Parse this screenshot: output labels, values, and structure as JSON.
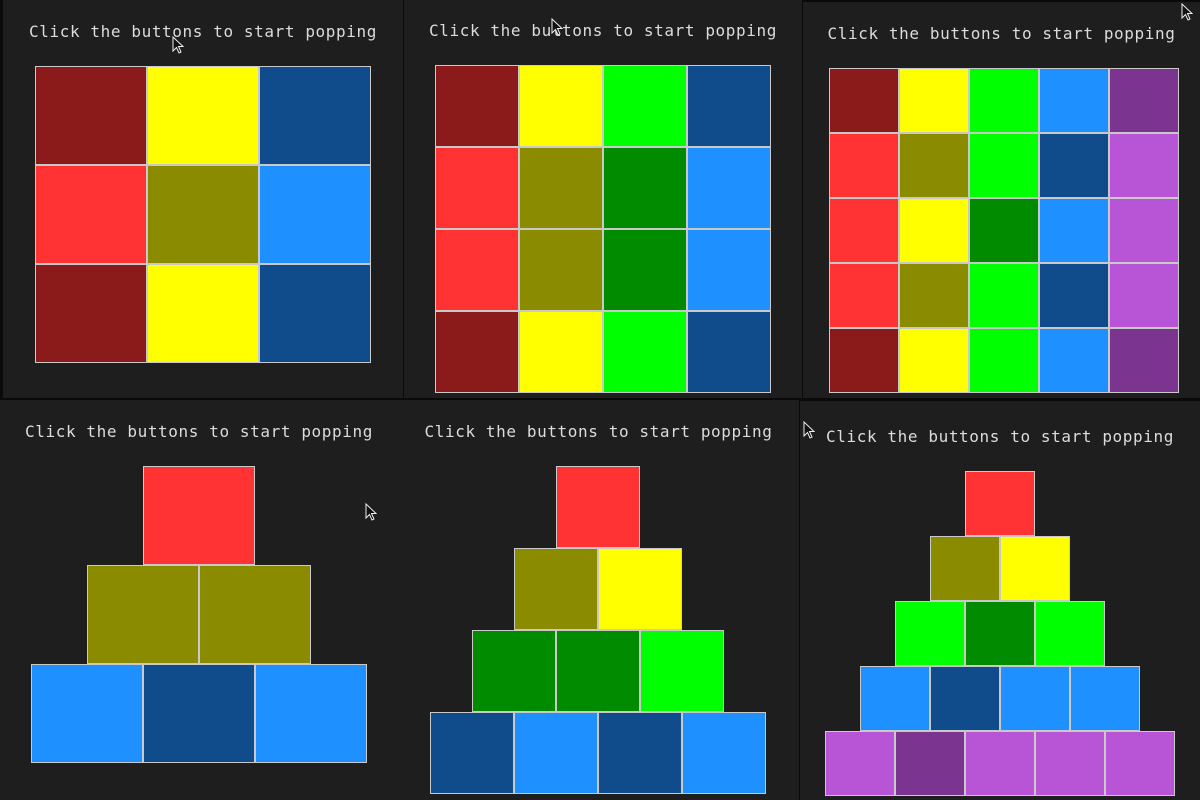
{
  "title": "Click the buttons to start popping",
  "colors": {
    "dark-red": "#8b1a1a",
    "red": "#ff3333",
    "yellow": "#ffff00",
    "olive": "#8b8b00",
    "lime": "#00ff00",
    "green": "#008b00",
    "blue": "#1e90ff",
    "navy": "#104c8b",
    "purple": "#7b3590",
    "orchid": "#b854d6"
  },
  "grids": [
    {
      "rows": [
        [
          "dark-red",
          "yellow",
          "navy"
        ],
        [
          "red",
          "olive",
          "blue"
        ],
        [
          "dark-red",
          "yellow",
          "navy"
        ]
      ]
    },
    {
      "rows": [
        [
          "dark-red",
          "yellow",
          "lime",
          "navy"
        ],
        [
          "red",
          "olive",
          "green",
          "blue"
        ],
        [
          "red",
          "olive",
          "green",
          "blue"
        ],
        [
          "dark-red",
          "yellow",
          "lime",
          "navy"
        ]
      ]
    },
    {
      "rows": [
        [
          "dark-red",
          "yellow",
          "lime",
          "blue",
          "purple"
        ],
        [
          "red",
          "olive",
          "lime",
          "navy",
          "orchid"
        ],
        [
          "red",
          "yellow",
          "green",
          "blue",
          "orchid"
        ],
        [
          "red",
          "olive",
          "lime",
          "navy",
          "orchid"
        ],
        [
          "dark-red",
          "yellow",
          "lime",
          "blue",
          "purple"
        ]
      ]
    }
  ],
  "pyramids": [
    {
      "rows": [
        [
          "red"
        ],
        [
          "olive",
          "olive"
        ],
        [
          "blue",
          "navy",
          "blue"
        ]
      ]
    },
    {
      "rows": [
        [
          "red"
        ],
        [
          "olive",
          "yellow"
        ],
        [
          "green",
          "green",
          "lime"
        ],
        [
          "navy",
          "blue",
          "navy",
          "blue"
        ]
      ]
    },
    {
      "rows": [
        [
          "red"
        ],
        [
          "olive",
          "yellow"
        ],
        [
          "lime",
          "green",
          "lime"
        ],
        [
          "blue",
          "navy",
          "blue",
          "blue"
        ],
        [
          "orchid",
          "purple",
          "orchid",
          "orchid",
          "orchid"
        ]
      ]
    }
  ]
}
